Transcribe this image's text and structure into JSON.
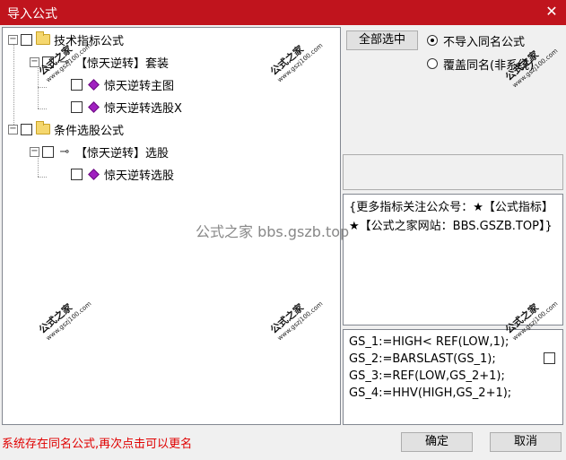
{
  "window": {
    "title": "导入公式"
  },
  "tree": {
    "nodes": [
      {
        "label": "技术指标公式",
        "type": "folder"
      },
      {
        "label": "【惊天逆转】套装",
        "type": "group"
      },
      {
        "label": "惊天逆转主图",
        "type": "formula"
      },
      {
        "label": "惊天逆转选股X",
        "type": "formula"
      },
      {
        "label": "条件选股公式",
        "type": "folder"
      },
      {
        "label": "【惊天逆转】选股",
        "type": "group"
      },
      {
        "label": "惊天逆转选股",
        "type": "formula"
      }
    ]
  },
  "options": {
    "select_all_label": "全部选中",
    "radio_skip_label": "不导入同名公式",
    "radio_overwrite_label": "覆盖同名(非系统)",
    "selected": "skip"
  },
  "description": {
    "text": "{更多指标关注公众号：★【公式指标】★【公式之家网站：BBS.GSZB.TOP】}"
  },
  "code": {
    "lines": [
      "GS_1:=HIGH< REF(LOW,1);",
      "GS_2:=BARSLAST(GS_1);",
      "GS_3:=REF(LOW,GS_2+1);",
      "GS_4:=HHV(HIGH,GS_2+1);"
    ]
  },
  "status": {
    "message": "系统存在同名公式,再次点击可以更名"
  },
  "buttons": {
    "ok_label": "确定",
    "cancel_label": "取消"
  },
  "watermark": {
    "brand": "公式之家",
    "url": "www.gszj100.com",
    "center_text": "公式之家 bbs.gszb.top"
  },
  "colors": {
    "titlebar": "#c0141d",
    "status_text": "#e00000",
    "formula_icon": "#a020c0"
  }
}
